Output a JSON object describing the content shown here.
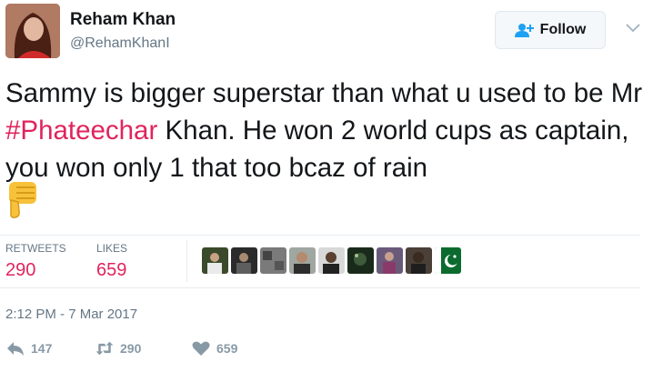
{
  "user": {
    "name": "Reham Khan",
    "handle": "@RehamKhanI"
  },
  "follow": {
    "label": "Follow"
  },
  "tweet": {
    "text_part1": "Sammy is bigger superstar than what u used to be Mr ",
    "hashtag": "#Phateechar",
    "text_part2": " Khan. He won 2 world cups as captain, you won only 1 that too bcaz of rain",
    "emoji": "thumbs-down-emoji"
  },
  "stats": {
    "retweets_label": "RETWEETS",
    "retweets_value": "290",
    "likes_label": "LIKES",
    "likes_value": "659"
  },
  "likers": [
    "liker-1",
    "liker-2",
    "liker-3",
    "liker-4",
    "liker-5",
    "liker-6",
    "liker-7",
    "liker-8",
    "liker-9-pakistan-flag"
  ],
  "timestamp": "2:12 PM - 7 Mar 2017",
  "actions": {
    "reply_count": "147",
    "retweet_count": "290",
    "like_count": "659"
  },
  "colors": {
    "accent": "#e0245e",
    "muted": "#657786",
    "follow_icon": "#1da1f2"
  }
}
